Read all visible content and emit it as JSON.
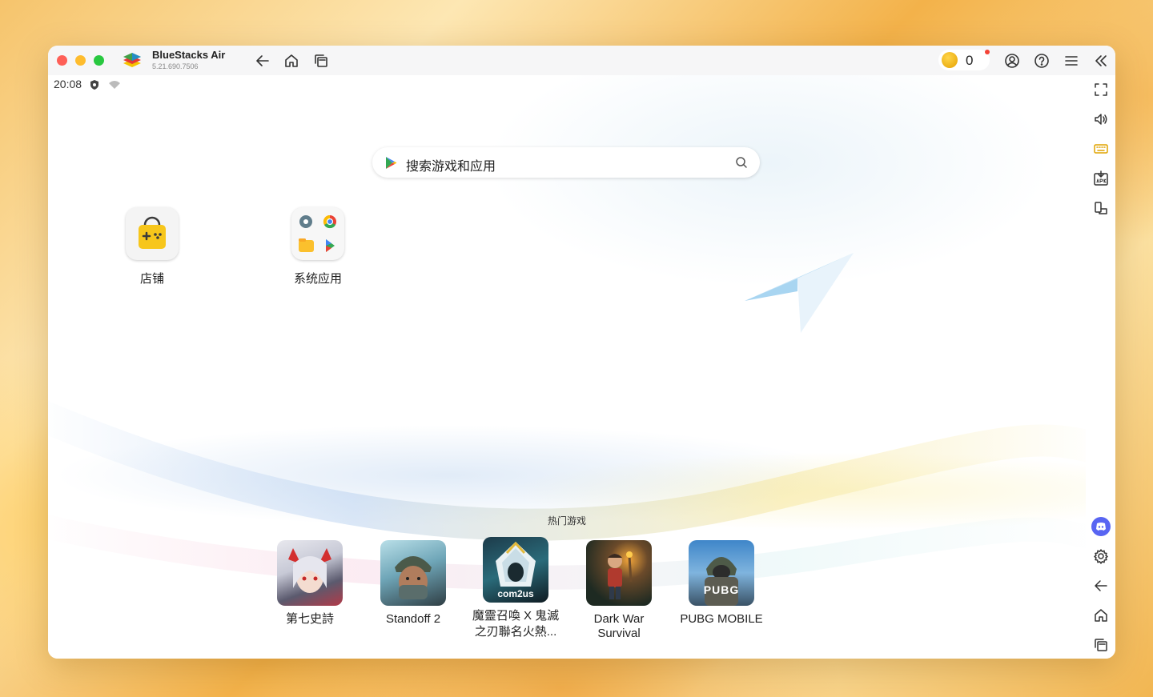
{
  "app": {
    "name": "BlueStacks Air",
    "version": "5.21.690.7506"
  },
  "titlebar": {
    "coin_count": "0"
  },
  "statusbar": {
    "time": "20:08"
  },
  "search": {
    "placeholder": "搜索游戏和应用"
  },
  "apps": [
    {
      "label": "店铺",
      "icon": "store-bag-icon"
    },
    {
      "label": "系统应用",
      "icon": "system-apps-folder-icon"
    }
  ],
  "hot_games": {
    "title": "热门游戏",
    "items": [
      {
        "label": "第七史詩"
      },
      {
        "label": "Standoff 2"
      },
      {
        "label": "魔靈召喚 X 鬼滅",
        "label2": "之刃聯名火熱...",
        "badge": "com2us"
      },
      {
        "label": "Dark War",
        "label2": "Survival"
      },
      {
        "label": "PUBG MOBILE",
        "badge": "PUBG"
      }
    ]
  },
  "colors": {
    "accent": "#5865f2",
    "coin": "#f2b418"
  }
}
